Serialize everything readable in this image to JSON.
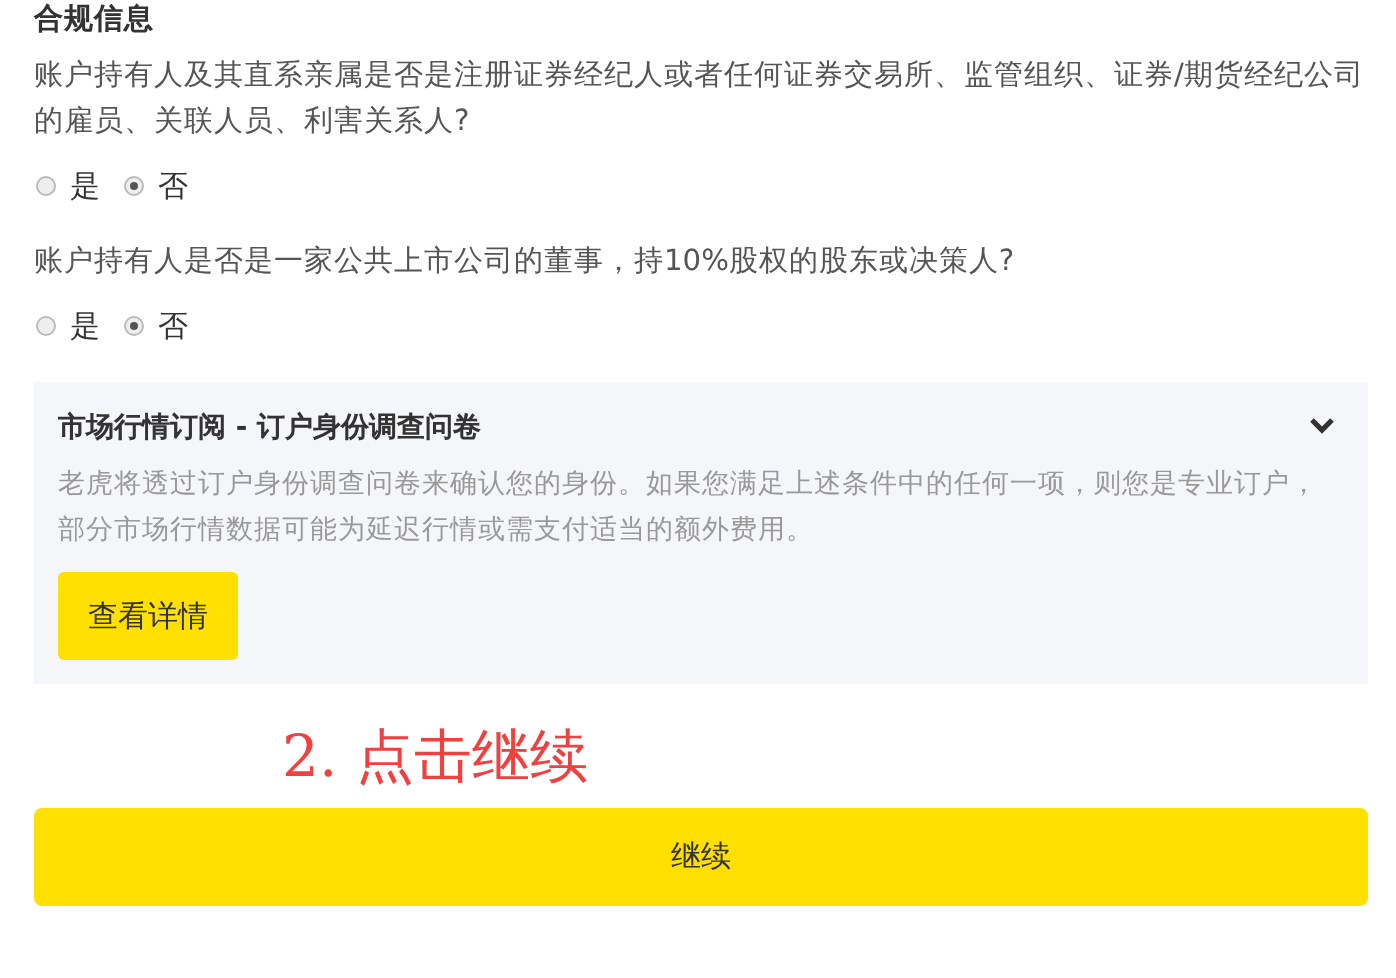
{
  "section_title": "合规信息",
  "questions": [
    {
      "text": "账户持有人及其直系亲属是否是注册证券经纪人或者任何证券交易所、监管组织、证券/期货经纪公司的雇员、关联人员、利害关系人?",
      "options": [
        {
          "label": "是",
          "selected": false
        },
        {
          "label": "否",
          "selected": true
        }
      ]
    },
    {
      "text": "账户持有人是否是一家公共上市公司的董事，持10%股权的股东或决策人?",
      "options": [
        {
          "label": "是",
          "selected": false
        },
        {
          "label": "否",
          "selected": true
        }
      ]
    }
  ],
  "panel": {
    "title": "市场行情订阅 - 订户身份调查问卷",
    "description": "老虎将透过订户身份调查问卷来确认您的身份。如果您满足上述条件中的任何一项，则您是专业订户，部分市场行情数据可能为延迟行情或需支付适当的额外费用。",
    "button": "查看详情"
  },
  "annotation": "2. 点击继续",
  "continue_button": "继续"
}
